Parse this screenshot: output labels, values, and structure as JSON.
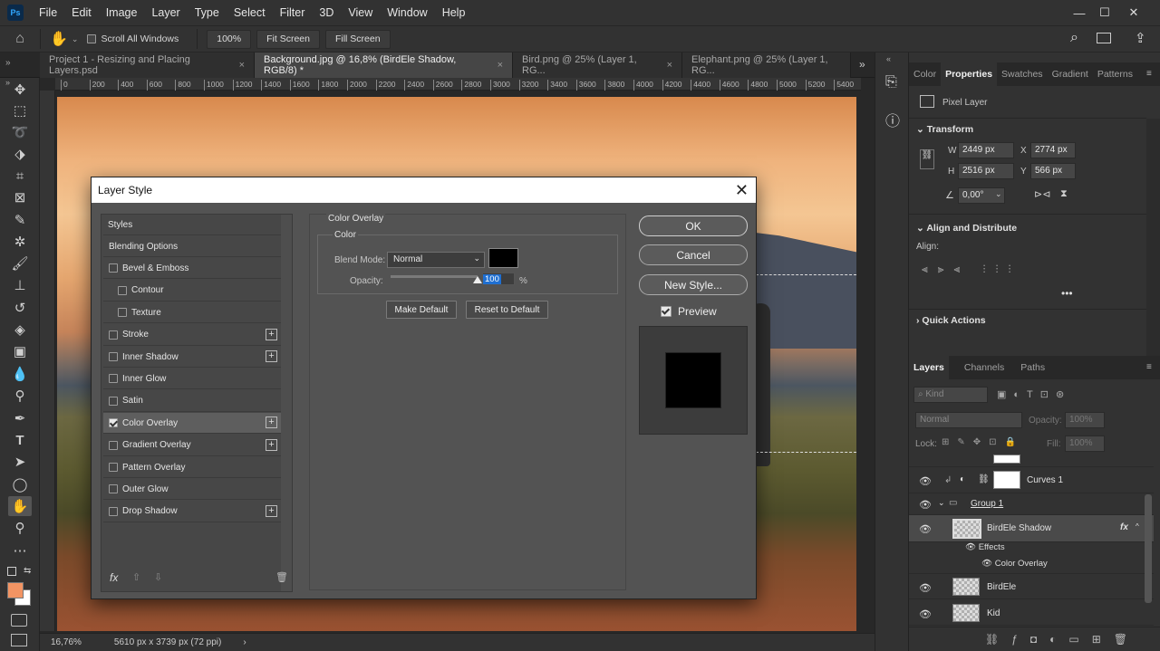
{
  "menu": {
    "logo": "Ps",
    "items": [
      "File",
      "Edit",
      "Image",
      "Layer",
      "Type",
      "Select",
      "Filter",
      "3D",
      "View",
      "Window",
      "Help"
    ]
  },
  "options_bar": {
    "scroll_all_windows": "Scroll All Windows",
    "zoom_value": "100%",
    "fit_screen": "Fit Screen",
    "fill_screen": "Fill Screen"
  },
  "tabs": [
    {
      "label": "Project 1 - Resizing and Placing Layers.psd"
    },
    {
      "label": "Background.jpg @ 16,8% (BirdEle Shadow, RGB/8) *"
    },
    {
      "label": "Bird.png @ 25% (Layer 1, RG..."
    },
    {
      "label": "Elephant.png @ 25% (Layer 1, RG..."
    }
  ],
  "ruler_ticks": [
    "0",
    "200",
    "400",
    "600",
    "800",
    "1000",
    "1200",
    "1400",
    "1600",
    "1800",
    "2000",
    "2200",
    "2400",
    "2600",
    "2800",
    "3000",
    "3200",
    "3400",
    "3600",
    "3800",
    "4000",
    "4200",
    "4400",
    "4600",
    "4800",
    "5000",
    "5200",
    "5400"
  ],
  "status": {
    "zoom": "16,76%",
    "dimensions": "5610 px x 3739 px (72 ppi)"
  },
  "dialog": {
    "title": "Layer Style",
    "styles_header": "Styles",
    "items": [
      {
        "label": "Blending Options",
        "checkbox": false,
        "checked": false,
        "plus": false,
        "indent": false
      },
      {
        "label": "Bevel & Emboss",
        "checkbox": true,
        "checked": false,
        "plus": false,
        "indent": false
      },
      {
        "label": "Contour",
        "checkbox": true,
        "checked": false,
        "plus": false,
        "indent": true
      },
      {
        "label": "Texture",
        "checkbox": true,
        "checked": false,
        "plus": false,
        "indent": true
      },
      {
        "label": "Stroke",
        "checkbox": true,
        "checked": false,
        "plus": true,
        "indent": false
      },
      {
        "label": "Inner Shadow",
        "checkbox": true,
        "checked": false,
        "plus": true,
        "indent": false
      },
      {
        "label": "Inner Glow",
        "checkbox": true,
        "checked": false,
        "plus": false,
        "indent": false
      },
      {
        "label": "Satin",
        "checkbox": true,
        "checked": false,
        "plus": false,
        "indent": false
      },
      {
        "label": "Color Overlay",
        "checkbox": true,
        "checked": true,
        "plus": true,
        "indent": false
      },
      {
        "label": "Gradient Overlay",
        "checkbox": true,
        "checked": false,
        "plus": true,
        "indent": false
      },
      {
        "label": "Pattern Overlay",
        "checkbox": true,
        "checked": false,
        "plus": false,
        "indent": false
      },
      {
        "label": "Outer Glow",
        "checkbox": true,
        "checked": false,
        "plus": false,
        "indent": false
      },
      {
        "label": "Drop Shadow",
        "checkbox": true,
        "checked": false,
        "plus": true,
        "indent": false
      }
    ],
    "section_title": "Color Overlay",
    "group_title": "Color",
    "blend_mode_label": "Blend Mode:",
    "blend_mode_value": "Normal",
    "overlay_color": "#000000",
    "opacity_label": "Opacity:",
    "opacity_value": "100",
    "opacity_unit": "%",
    "opacity_fraction": 1.0,
    "make_default": "Make Default",
    "reset_default": "Reset to Default",
    "ok": "OK",
    "cancel": "Cancel",
    "new_style": "New Style...",
    "preview": "Preview",
    "fx": "fx"
  },
  "properties": {
    "tabs": [
      "Color",
      "Properties",
      "Swatches",
      "Gradient",
      "Patterns"
    ],
    "layer_type": "Pixel Layer",
    "transform_title": "Transform",
    "w_label": "W",
    "w_value": "2449 px",
    "h_label": "H",
    "h_value": "2516 px",
    "x_label": "X",
    "x_value": "2774 px",
    "y_label": "Y",
    "y_value": "566 px",
    "angle_value": "0,00°",
    "align_title": "Align and Distribute",
    "align_label": "Align:",
    "quick_actions": "Quick Actions"
  },
  "layers_panel": {
    "tabs": [
      "Layers",
      "Channels",
      "Paths"
    ],
    "kind": "Kind",
    "blend": "Normal",
    "opacity_label": "Opacity:",
    "opacity_value": "100%",
    "lock_label": "Lock:",
    "fill_label": "Fill:",
    "fill_value": "100%",
    "layers": [
      {
        "name": "Curves 1"
      },
      {
        "name": "Group 1"
      },
      {
        "name": "BirdEle Shadow"
      },
      {
        "name": "Effects"
      },
      {
        "name": "Color Overlay"
      },
      {
        "name": "BirdEle"
      },
      {
        "name": "Kid"
      }
    ],
    "fx_label": "fx"
  }
}
